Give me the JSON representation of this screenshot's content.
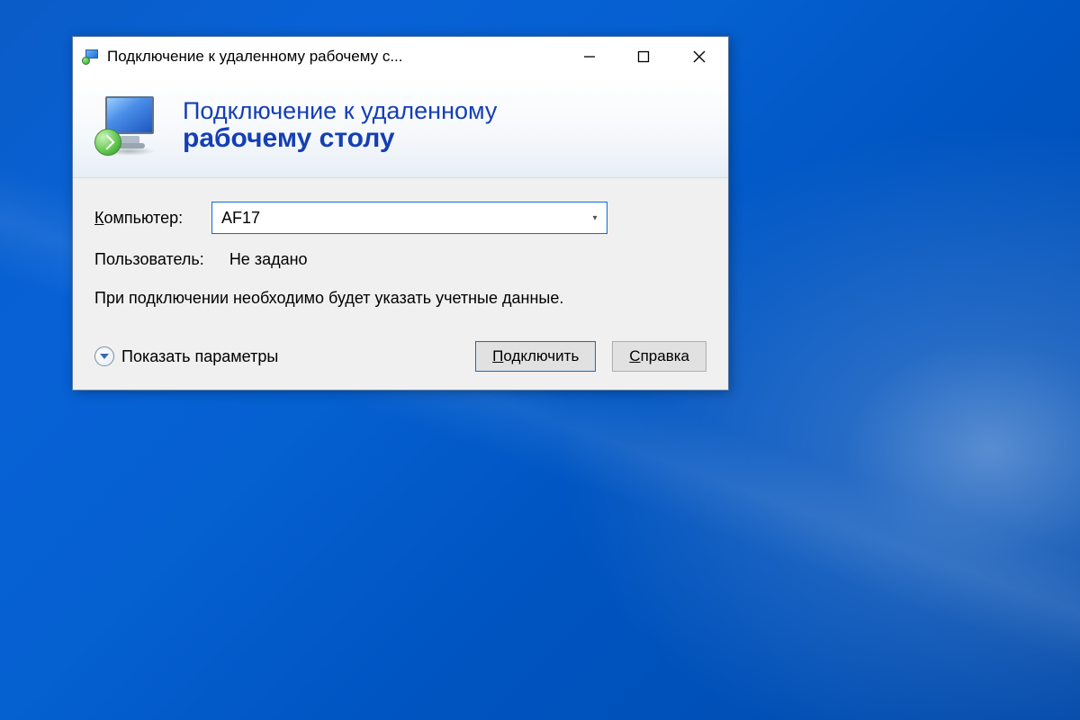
{
  "window": {
    "title": "Подключение к удаленному рабочему с..."
  },
  "banner": {
    "line1": "Подключение к удаленному",
    "line2": "рабочему столу"
  },
  "fields": {
    "computer_label_prefix": "К",
    "computer_label_rest": "омпьютер:",
    "computer_value": "AF17",
    "user_label": "Пользователь:",
    "user_value": "Не задано"
  },
  "info": "При подключении необходимо будет указать учетные данные.",
  "footer": {
    "expand_prefix": "П",
    "expand_rest": "оказать параметры",
    "connect_prefix": "П",
    "connect_rest": "одключить",
    "help_prefix": "С",
    "help_rest": "правка"
  }
}
